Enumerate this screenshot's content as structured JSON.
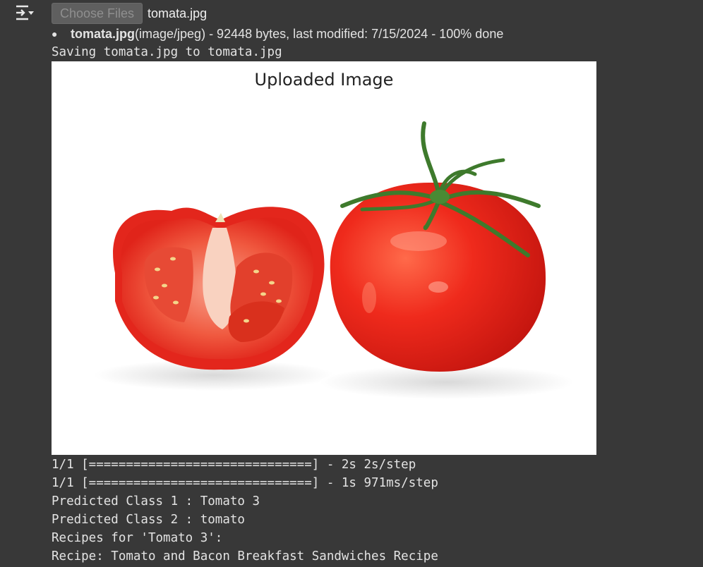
{
  "upload": {
    "button_label": "Choose Files",
    "file_name": "tomata.jpg",
    "status_name": "tomata.jpg",
    "status_detail": "(image/jpeg) - 92448 bytes, last modified: 7/15/2024 - 100% done"
  },
  "output_lines": {
    "saving": "Saving tomata.jpg to tomata.jpg",
    "progress_1": "1/1 [==============================] - 2s 2s/step",
    "progress_2": "1/1 [==============================] - 1s 971ms/step",
    "predicted_1": "Predicted Class 1 : Tomato 3",
    "predicted_2": "Predicted Class 2 : tomato",
    "recipes_header": "Recipes for 'Tomato 3':",
    "recipe_1": "Recipe: Tomato and Bacon Breakfast Sandwiches Recipe"
  },
  "figure": {
    "title": "Uploaded Image"
  },
  "icons": {
    "output_toggle": "output-toggle-icon"
  },
  "colors": {
    "background": "#383838",
    "text": "#e3e3e3",
    "tomato_red": "#e8221b"
  }
}
